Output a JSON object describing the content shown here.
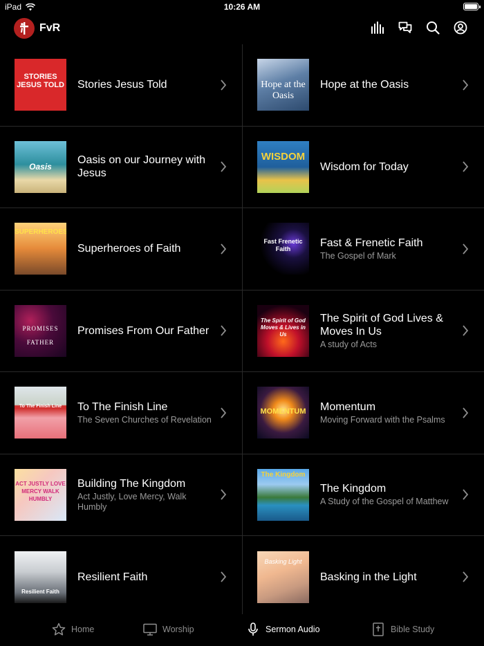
{
  "status": {
    "device": "iPad",
    "time": "10:26 AM"
  },
  "header": {
    "app_name": "FvR",
    "icons": [
      "bars-icon",
      "chat-icon",
      "search-icon",
      "account-icon"
    ]
  },
  "series": [
    {
      "title": "Stories Jesus Told",
      "subtitle": "",
      "thumb_text": "STORIES JESUS TOLD"
    },
    {
      "title": "Hope at the Oasis",
      "subtitle": "",
      "thumb_text": "Hope at the Oasis"
    },
    {
      "title": "Oasis on our Journey with Jesus",
      "subtitle": "",
      "thumb_text": "Oasis"
    },
    {
      "title": "Wisdom for Today",
      "subtitle": "",
      "thumb_text": "WISDOM"
    },
    {
      "title": "Superheroes of Faith",
      "subtitle": "",
      "thumb_text": "SUPERHEROES"
    },
    {
      "title": "Fast & Frenetic Faith",
      "subtitle": "The Gospel of Mark",
      "thumb_text": "Fast Frenetic Faith"
    },
    {
      "title": "Promises From Our Father",
      "subtitle": "",
      "thumb_text": "PROMISES FATHER"
    },
    {
      "title": "The Spirit of God Lives & Moves In Us",
      "subtitle": "A study of Acts",
      "thumb_text": "The Spirit of God Moves & Lives in Us"
    },
    {
      "title": "To The Finish Line",
      "subtitle": "The Seven Churches of Revelation",
      "thumb_text": "To The Finish Line"
    },
    {
      "title": "Momentum",
      "subtitle": "Moving Forward with the Psalms",
      "thumb_text": "MOMENTUM"
    },
    {
      "title": "Building The Kingdom",
      "subtitle": "Act Justly, Love Mercy, Walk Humbly",
      "thumb_text": "ACT JUSTLY LOVE MERCY WALK HUMBLY"
    },
    {
      "title": "The Kingdom",
      "subtitle": "A Study of the Gospel of Matthew",
      "thumb_text": "The Kingdom"
    },
    {
      "title": "Resilient Faith",
      "subtitle": "",
      "thumb_text": "Resilient Faith"
    },
    {
      "title": "Basking in the Light",
      "subtitle": "",
      "thumb_text": "Basking Light"
    }
  ],
  "tabs": [
    {
      "label": "Home",
      "icon": "star-icon",
      "active": false
    },
    {
      "label": "Worship",
      "icon": "monitor-icon",
      "active": false
    },
    {
      "label": "Sermon Audio",
      "icon": "microphone-icon",
      "active": true
    },
    {
      "label": "Bible Study",
      "icon": "bible-icon",
      "active": false
    }
  ],
  "colors": {
    "background": "#000000",
    "logo": "#b3201f",
    "divider": "#2a2a2a",
    "subtitle": "#9a9a9a",
    "tab_inactive": "#8e8e8e"
  }
}
